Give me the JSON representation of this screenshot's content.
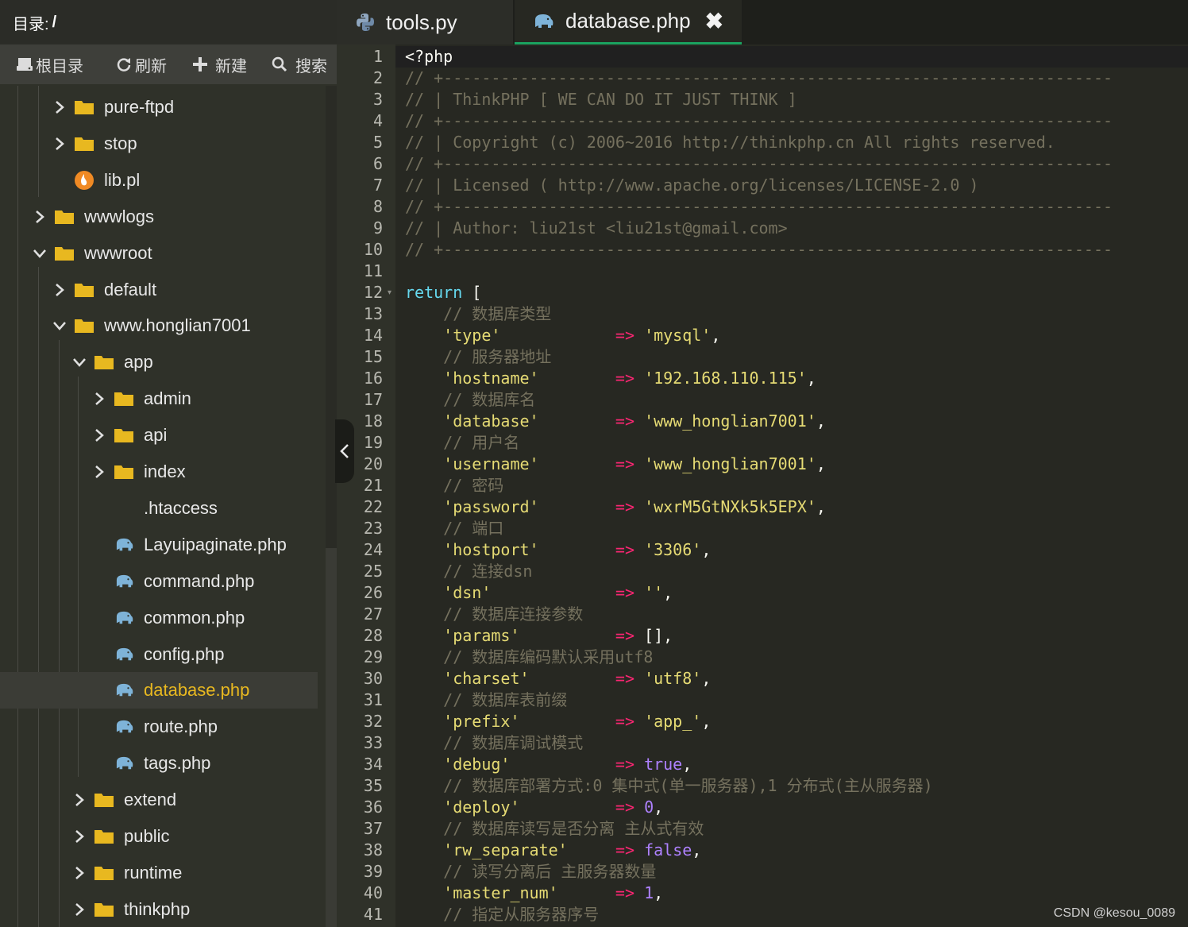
{
  "sidebar": {
    "dir_label": "目录:",
    "dir_path": "/",
    "toolbar": {
      "root": "根目录",
      "refresh": "刷新",
      "new": "新建",
      "search": "搜索"
    },
    "tree": [
      {
        "label": "pure-ftpd",
        "kind": "folder",
        "expanded": false
      },
      {
        "label": "stop",
        "kind": "folder",
        "expanded": false
      },
      {
        "label": "lib.pl",
        "kind": "perl-file"
      },
      {
        "label": "wwwlogs",
        "kind": "folder",
        "expanded": false
      },
      {
        "label": "wwwroot",
        "kind": "folder",
        "expanded": true
      },
      {
        "label": "default",
        "kind": "folder",
        "expanded": false
      },
      {
        "label": "www.honglian7001",
        "kind": "folder",
        "expanded": true
      },
      {
        "label": "app",
        "kind": "folder",
        "expanded": true
      },
      {
        "label": "admin",
        "kind": "folder",
        "expanded": false
      },
      {
        "label": "api",
        "kind": "folder",
        "expanded": false
      },
      {
        "label": "index",
        "kind": "folder",
        "expanded": false
      },
      {
        "label": ".htaccess",
        "kind": "file"
      },
      {
        "label": "Layuipaginate.php",
        "kind": "php-file"
      },
      {
        "label": "command.php",
        "kind": "php-file"
      },
      {
        "label": "common.php",
        "kind": "php-file"
      },
      {
        "label": "config.php",
        "kind": "php-file"
      },
      {
        "label": "database.php",
        "kind": "php-file",
        "selected": true
      },
      {
        "label": "route.php",
        "kind": "php-file"
      },
      {
        "label": "tags.php",
        "kind": "php-file"
      },
      {
        "label": "extend",
        "kind": "folder",
        "expanded": false
      },
      {
        "label": "public",
        "kind": "folder",
        "expanded": false
      },
      {
        "label": "runtime",
        "kind": "folder",
        "expanded": false
      },
      {
        "label": "thinkphp",
        "kind": "folder",
        "expanded": false
      }
    ]
  },
  "tabs": [
    {
      "label": "tools.py",
      "icon": "python-icon",
      "active": false
    },
    {
      "label": "database.php",
      "icon": "php-elephant-icon",
      "active": true,
      "close": "✖"
    }
  ],
  "editor": {
    "lines": [
      [
        [
          "pl",
          "<?php"
        ]
      ],
      [
        [
          "cm",
          "// +----------------------------------------------------------------------"
        ]
      ],
      [
        [
          "cm",
          "// | ThinkPHP [ WE CAN DO IT JUST THINK ]"
        ]
      ],
      [
        [
          "cm",
          "// +----------------------------------------------------------------------"
        ]
      ],
      [
        [
          "cm",
          "// | Copyright (c) 2006~2016 http://thinkphp.cn All rights reserved."
        ]
      ],
      [
        [
          "cm",
          "// +----------------------------------------------------------------------"
        ]
      ],
      [
        [
          "cm",
          "// | Licensed ( http://www.apache.org/licenses/LICENSE-2.0 )"
        ]
      ],
      [
        [
          "cm",
          "// +----------------------------------------------------------------------"
        ]
      ],
      [
        [
          "cm",
          "// | Author: liu21st <liu21st@gmail.com>"
        ]
      ],
      [
        [
          "cm",
          "// +----------------------------------------------------------------------"
        ]
      ],
      [],
      [
        [
          "kw",
          "return"
        ],
        [
          "pl",
          " ["
        ]
      ],
      [
        [
          "pl",
          "    "
        ],
        [
          "cm",
          "// 数据库类型"
        ]
      ],
      [
        [
          "pl",
          "    "
        ],
        [
          "str",
          "'type'"
        ],
        [
          "pl",
          "            "
        ],
        [
          "op",
          "=>"
        ],
        [
          "pl",
          " "
        ],
        [
          "str",
          "'mysql'"
        ],
        [
          "pl",
          ","
        ]
      ],
      [
        [
          "pl",
          "    "
        ],
        [
          "cm",
          "// 服务器地址"
        ]
      ],
      [
        [
          "pl",
          "    "
        ],
        [
          "str",
          "'hostname'"
        ],
        [
          "pl",
          "        "
        ],
        [
          "op",
          "=>"
        ],
        [
          "pl",
          " "
        ],
        [
          "str",
          "'192.168.110.115'"
        ],
        [
          "pl",
          ","
        ]
      ],
      [
        [
          "pl",
          "    "
        ],
        [
          "cm",
          "// 数据库名"
        ]
      ],
      [
        [
          "pl",
          "    "
        ],
        [
          "str",
          "'database'"
        ],
        [
          "pl",
          "        "
        ],
        [
          "op",
          "=>"
        ],
        [
          "pl",
          " "
        ],
        [
          "str",
          "'www_honglian7001'"
        ],
        [
          "pl",
          ","
        ]
      ],
      [
        [
          "pl",
          "    "
        ],
        [
          "cm",
          "// 用户名"
        ]
      ],
      [
        [
          "pl",
          "    "
        ],
        [
          "str",
          "'username'"
        ],
        [
          "pl",
          "        "
        ],
        [
          "op",
          "=>"
        ],
        [
          "pl",
          " "
        ],
        [
          "str",
          "'www_honglian7001'"
        ],
        [
          "pl",
          ","
        ]
      ],
      [
        [
          "pl",
          "    "
        ],
        [
          "cm",
          "// 密码"
        ]
      ],
      [
        [
          "pl",
          "    "
        ],
        [
          "str",
          "'password'"
        ],
        [
          "pl",
          "        "
        ],
        [
          "op",
          "=>"
        ],
        [
          "pl",
          " "
        ],
        [
          "str",
          "'wxrM5GtNXk5k5EPX'"
        ],
        [
          "pl",
          ","
        ]
      ],
      [
        [
          "pl",
          "    "
        ],
        [
          "cm",
          "// 端口"
        ]
      ],
      [
        [
          "pl",
          "    "
        ],
        [
          "str",
          "'hostport'"
        ],
        [
          "pl",
          "        "
        ],
        [
          "op",
          "=>"
        ],
        [
          "pl",
          " "
        ],
        [
          "str",
          "'3306'"
        ],
        [
          "pl",
          ","
        ]
      ],
      [
        [
          "pl",
          "    "
        ],
        [
          "cm",
          "// 连接dsn"
        ]
      ],
      [
        [
          "pl",
          "    "
        ],
        [
          "str",
          "'dsn'"
        ],
        [
          "pl",
          "             "
        ],
        [
          "op",
          "=>"
        ],
        [
          "pl",
          " "
        ],
        [
          "str",
          "''"
        ],
        [
          "pl",
          ","
        ]
      ],
      [
        [
          "pl",
          "    "
        ],
        [
          "cm",
          "// 数据库连接参数"
        ]
      ],
      [
        [
          "pl",
          "    "
        ],
        [
          "str",
          "'params'"
        ],
        [
          "pl",
          "          "
        ],
        [
          "op",
          "=>"
        ],
        [
          "pl",
          " [],"
        ]
      ],
      [
        [
          "pl",
          "    "
        ],
        [
          "cm",
          "// 数据库编码默认采用utf8"
        ]
      ],
      [
        [
          "pl",
          "    "
        ],
        [
          "str",
          "'charset'"
        ],
        [
          "pl",
          "         "
        ],
        [
          "op",
          "=>"
        ],
        [
          "pl",
          " "
        ],
        [
          "str",
          "'utf8'"
        ],
        [
          "pl",
          ","
        ]
      ],
      [
        [
          "pl",
          "    "
        ],
        [
          "cm",
          "// 数据库表前缀"
        ]
      ],
      [
        [
          "pl",
          "    "
        ],
        [
          "str",
          "'prefix'"
        ],
        [
          "pl",
          "          "
        ],
        [
          "op",
          "=>"
        ],
        [
          "pl",
          " "
        ],
        [
          "str",
          "'app_'"
        ],
        [
          "pl",
          ","
        ]
      ],
      [
        [
          "pl",
          "    "
        ],
        [
          "cm",
          "// 数据库调试模式"
        ]
      ],
      [
        [
          "pl",
          "    "
        ],
        [
          "str",
          "'debug'"
        ],
        [
          "pl",
          "           "
        ],
        [
          "op",
          "=>"
        ],
        [
          "pl",
          " "
        ],
        [
          "num",
          "true"
        ],
        [
          "pl",
          ","
        ]
      ],
      [
        [
          "pl",
          "    "
        ],
        [
          "cm",
          "// 数据库部署方式:0 集中式(单一服务器),1 分布式(主从服务器)"
        ]
      ],
      [
        [
          "pl",
          "    "
        ],
        [
          "str",
          "'deploy'"
        ],
        [
          "pl",
          "          "
        ],
        [
          "op",
          "=>"
        ],
        [
          "pl",
          " "
        ],
        [
          "num",
          "0"
        ],
        [
          "pl",
          ","
        ]
      ],
      [
        [
          "pl",
          "    "
        ],
        [
          "cm",
          "// 数据库读写是否分离 主从式有效"
        ]
      ],
      [
        [
          "pl",
          "    "
        ],
        [
          "str",
          "'rw_separate'"
        ],
        [
          "pl",
          "     "
        ],
        [
          "op",
          "=>"
        ],
        [
          "pl",
          " "
        ],
        [
          "num",
          "false"
        ],
        [
          "pl",
          ","
        ]
      ],
      [
        [
          "pl",
          "    "
        ],
        [
          "cm",
          "// 读写分离后 主服务器数量"
        ]
      ],
      [
        [
          "pl",
          "    "
        ],
        [
          "str",
          "'master_num'"
        ],
        [
          "pl",
          "      "
        ],
        [
          "op",
          "=>"
        ],
        [
          "pl",
          " "
        ],
        [
          "num",
          "1"
        ],
        [
          "pl",
          ","
        ]
      ],
      [
        [
          "pl",
          "    "
        ],
        [
          "cm",
          "// 指定从服务器序号"
        ]
      ]
    ]
  },
  "watermark": "CSDN @kesou_0089",
  "colors": {
    "folder": "#e8b820",
    "selected_text": "#e8b820",
    "active_tab_underline": "#1aa260",
    "comment": "#75715e",
    "string": "#e6db74",
    "keyword": "#66d9ef",
    "operator": "#f92672",
    "constant": "#ae81ff"
  }
}
